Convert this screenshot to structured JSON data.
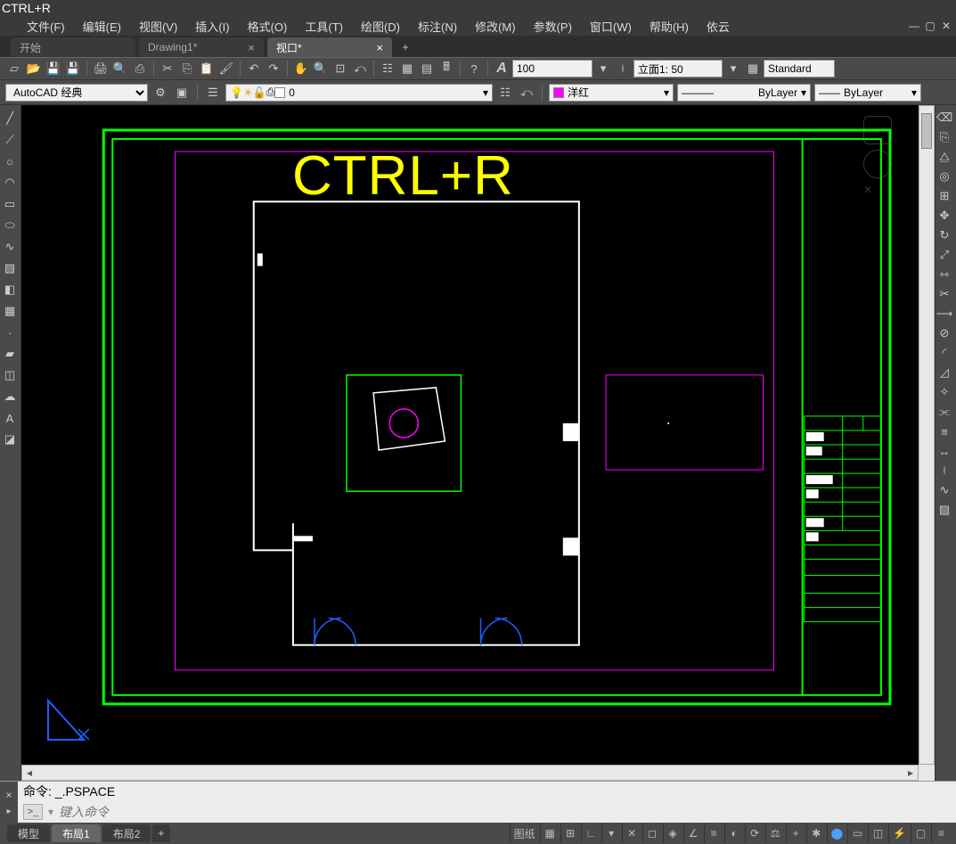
{
  "title_prefix": "CTRL+R",
  "menu": [
    "文件(F)",
    "编辑(E)",
    "视图(V)",
    "插入(I)",
    "格式(O)",
    "工具(T)",
    "绘图(D)",
    "标注(N)",
    "修改(M)",
    "参数(P)",
    "窗口(W)",
    "帮助(H)",
    "依云"
  ],
  "tabs": [
    {
      "label": "开始",
      "active": false,
      "closable": false
    },
    {
      "label": "Drawing1*",
      "active": false,
      "closable": true
    },
    {
      "label": "视口*",
      "active": true,
      "closable": true
    }
  ],
  "toolbar": {
    "workspace": "AutoCAD 经典",
    "layer_value": "0",
    "scale_value": "100",
    "view_value": "立面1: 50",
    "style_value": "Standard",
    "color_value": "洋红",
    "bylayer1": "ByLayer",
    "bylayer2": "ByLayer"
  },
  "overlay": "CTRL+R",
  "command": {
    "history": "命令:  _.PSPACE",
    "placeholder": "键入命令",
    "prompt": ">_"
  },
  "layout_tabs": [
    {
      "label": "模型",
      "active": false
    },
    {
      "label": "布局1",
      "active": true
    },
    {
      "label": "布局2",
      "active": false
    }
  ],
  "status": {
    "paper": "图纸"
  },
  "colors": {
    "magenta": "#ff00ff",
    "green": "#00ff00",
    "yellow": "#ffff00",
    "blue": "#0060ff"
  }
}
